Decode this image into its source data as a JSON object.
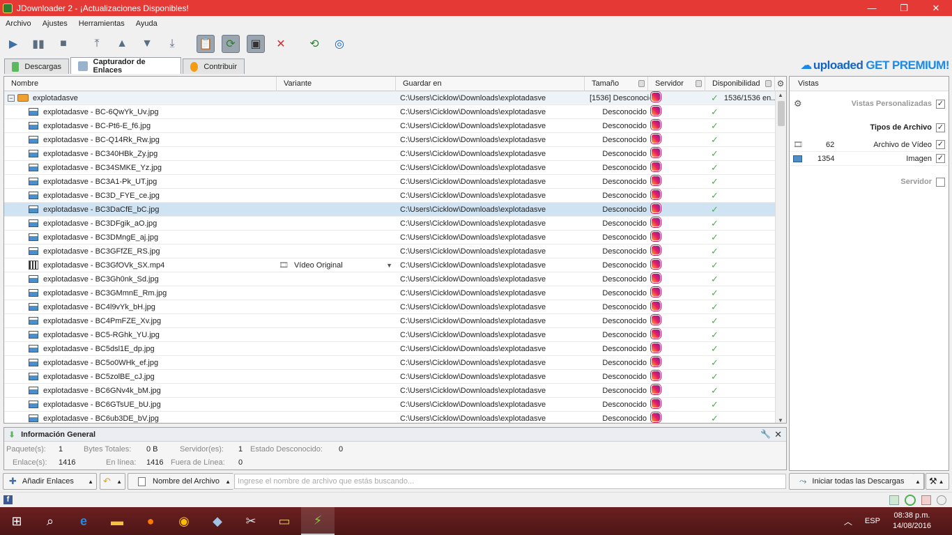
{
  "window": {
    "title": "JDownloader 2 - ¡Actualizaciones Disponibles!"
  },
  "menu": [
    "Archivo",
    "Ajustes",
    "Herramientas",
    "Ayuda"
  ],
  "tabs": [
    "Descargas",
    "Capturador de Enlaces",
    "Contribuir"
  ],
  "premium": {
    "brand": "uploaded",
    "cta": "GET PREMIUM!"
  },
  "columns": [
    "Nombre",
    "Variante",
    "Guardar en",
    "Tamaño",
    "Servidor",
    "Disponibilidad"
  ],
  "package": {
    "name": "explotadasve",
    "path": "C:\\Users\\Cicklow\\Downloads\\explotadasve",
    "size": "[1536]  Desconocido",
    "avail": "1536/1536 en..."
  },
  "path": "C:\\Users\\Cicklow\\Downloads\\explotadasve",
  "unknown": "Desconocido",
  "files": [
    {
      "name": "explotadasve - BC-6QwYk_Uv.jpg",
      "type": "img"
    },
    {
      "name": "explotadasve - BC-Pt6-E_f6.jpg",
      "type": "img"
    },
    {
      "name": "explotadasve - BC-Q14Rk_Rw.jpg",
      "type": "img"
    },
    {
      "name": "explotadasve - BC340HBk_Zy.jpg",
      "type": "img"
    },
    {
      "name": "explotadasve - BC34SMKE_Yz.jpg",
      "type": "img"
    },
    {
      "name": "explotadasve - BC3A1-Pk_UT.jpg",
      "type": "img"
    },
    {
      "name": "explotadasve - BC3D_FYE_ce.jpg",
      "type": "img"
    },
    {
      "name": "explotadasve - BC3DaCfE_bC.jpg",
      "type": "img",
      "selected": true
    },
    {
      "name": "explotadasve - BC3DFgik_aO.jpg",
      "type": "img"
    },
    {
      "name": "explotadasve - BC3DMngE_aj.jpg",
      "type": "img"
    },
    {
      "name": "explotadasve - BC3GFfZE_RS.jpg",
      "type": "img"
    },
    {
      "name": "explotadasve - BC3GfOVk_SX.mp4",
      "type": "vid",
      "variant": "Vídeo Original"
    },
    {
      "name": "explotadasve - BC3Gh0nk_Sd.jpg",
      "type": "img"
    },
    {
      "name": "explotadasve - BC3GMmnE_Rm.jpg",
      "type": "img"
    },
    {
      "name": "explotadasve - BC4l9vYk_bH.jpg",
      "type": "img"
    },
    {
      "name": "explotadasve - BC4PmFZE_Xv.jpg",
      "type": "img"
    },
    {
      "name": "explotadasve - BC5-RGhk_YU.jpg",
      "type": "img"
    },
    {
      "name": "explotadasve - BC5dsl1E_dp.jpg",
      "type": "img"
    },
    {
      "name": "explotadasve - BC5o0WHk_ef.jpg",
      "type": "img"
    },
    {
      "name": "explotadasve - BC5zolBE_cJ.jpg",
      "type": "img"
    },
    {
      "name": "explotadasve - BC6GNv4k_bM.jpg",
      "type": "img"
    },
    {
      "name": "explotadasve - BC6GTsUE_bU.jpg",
      "type": "img"
    },
    {
      "name": "explotadasve - BC6ub3DE_bV.jpg",
      "type": "img"
    }
  ],
  "views": {
    "title": "Vistas",
    "custom": "Vistas Personalizadas",
    "filetypes": "Tipos de Archivo",
    "video_count": "62",
    "video_label": "Archivo de Vídeo",
    "image_count": "1354",
    "image_label": "Imagen",
    "server": "Servidor"
  },
  "info": {
    "title": "Información General",
    "packages_label": "Paquete(s):",
    "packages": "1",
    "bytes_label": "Bytes Totales:",
    "bytes": "0 B",
    "servers_label": "Servidor(es):",
    "servers": "1",
    "unknown_label": "Estado Desconocido:",
    "unknown": "0",
    "links_label": "Enlace(s):",
    "links": "1416",
    "online_label": "En línea:",
    "online": "1416",
    "offline_label": "Fuera de Línea:",
    "offline": "0"
  },
  "bottom": {
    "add_links": "Añadir Enlaces",
    "filename_filter": "Nombre del Archivo",
    "search_placeholder": "Ingrese el nombre de archivo que estás buscando...",
    "start_all": "Iniciar todas las Descargas"
  },
  "taskbar": {
    "lang": "ESP",
    "time": "08:38 p.m.",
    "date": "14/08/2016"
  }
}
